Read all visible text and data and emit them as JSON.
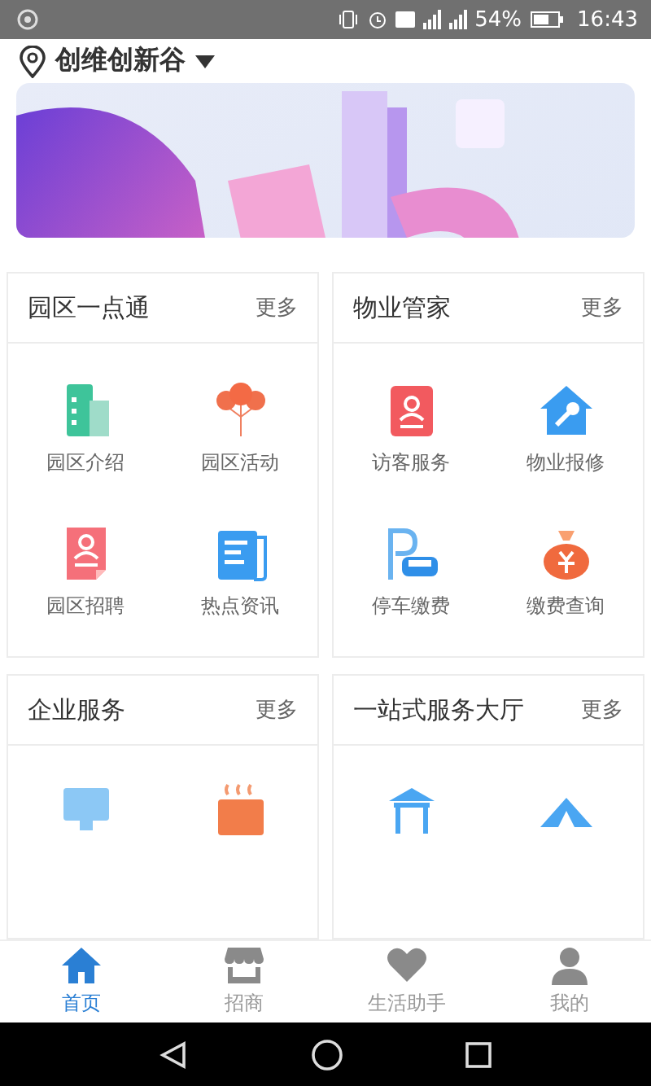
{
  "status_bar": {
    "battery": "54%",
    "time": "16:43"
  },
  "location": {
    "name": "创维创新谷"
  },
  "sections": [
    {
      "title": "园区一点通",
      "more": "更多",
      "items": [
        {
          "kind": "building",
          "label": "园区介绍"
        },
        {
          "kind": "balloons",
          "label": "园区活动"
        },
        {
          "kind": "resume",
          "label": "园区招聘"
        },
        {
          "kind": "news",
          "label": "热点资讯"
        }
      ]
    },
    {
      "title": "物业管家",
      "more": "更多",
      "items": [
        {
          "kind": "visitor",
          "label": "访客服务"
        },
        {
          "kind": "repair",
          "label": "物业报修"
        },
        {
          "kind": "parking",
          "label": "停车缴费"
        },
        {
          "kind": "payment",
          "label": "缴费查询"
        }
      ]
    },
    {
      "title": "企业服务",
      "more": "更多",
      "items": [
        {
          "kind": "monitor"
        },
        {
          "kind": "shop"
        }
      ]
    },
    {
      "title": "一站式服务大厅",
      "more": "更多",
      "items": [
        {
          "kind": "pavilion"
        },
        {
          "kind": "tent"
        }
      ]
    }
  ],
  "tabs": [
    {
      "label": "首页",
      "kind": "home",
      "selected": true
    },
    {
      "label": "招商",
      "kind": "store",
      "selected": false
    },
    {
      "label": "生活助手",
      "kind": "heart",
      "selected": false
    },
    {
      "label": "我的",
      "kind": "person",
      "selected": false
    }
  ]
}
